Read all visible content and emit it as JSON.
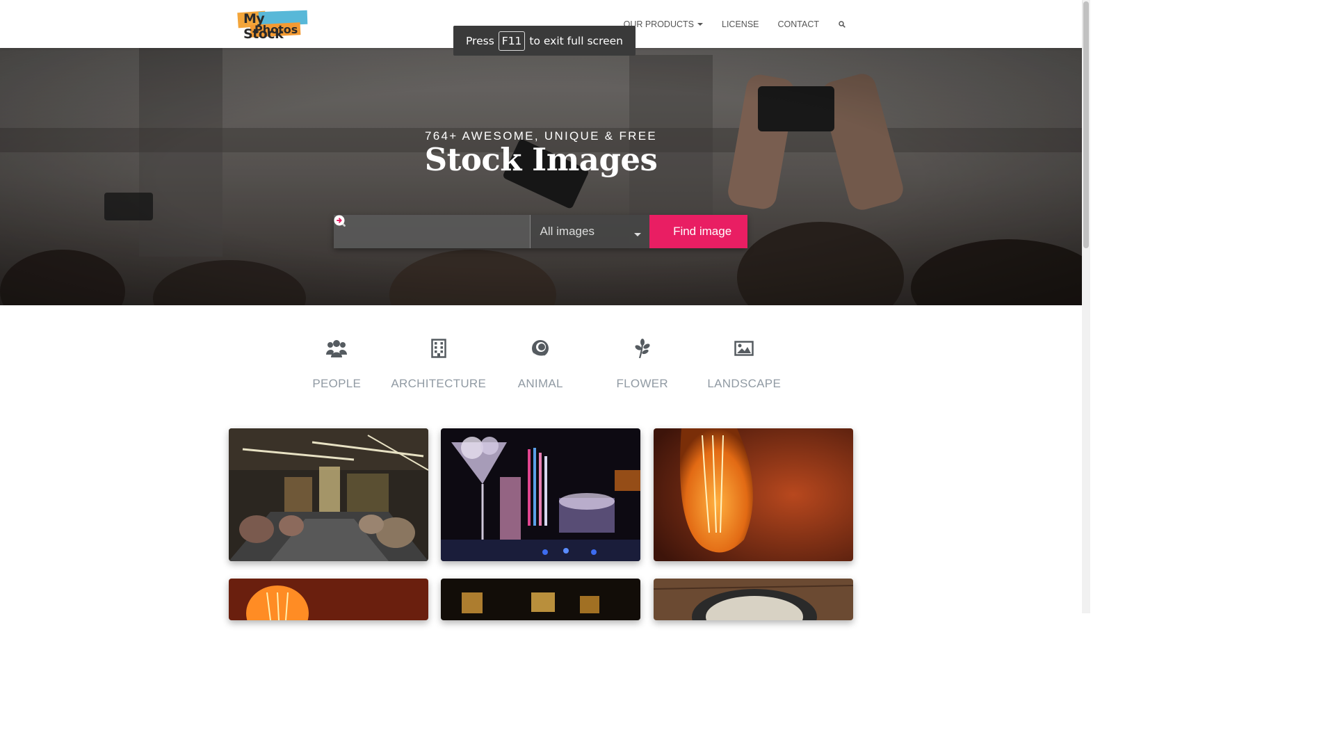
{
  "nav": {
    "logo_line1": "My Stock",
    "logo_line2": "Photos",
    "items": [
      {
        "label": "OUR PRODUCTS",
        "has_caret": true
      },
      {
        "label": "LICENSE"
      },
      {
        "label": "CONTACT"
      }
    ],
    "search_icon": "search-icon"
  },
  "fullscreen_notice": {
    "prefix": "Press",
    "key": "F11",
    "suffix": "to exit full screen"
  },
  "hero": {
    "subtitle": "764+ AWESOME, UNIQUE & FREE",
    "title": "Stock Images",
    "search": {
      "placeholder": "",
      "value": "",
      "select_value": "All images",
      "button_label": "Find image"
    }
  },
  "categories": [
    {
      "label": "PEOPLE",
      "icon": "users-icon"
    },
    {
      "label": "ARCHITECTURE",
      "icon": "building-icon"
    },
    {
      "label": "ANIMAL",
      "icon": "animal-icon"
    },
    {
      "label": "FLOWER",
      "icon": "leaf-icon"
    },
    {
      "label": "LANDSCAPE",
      "icon": "image-icon"
    }
  ],
  "gallery": [
    {
      "subject": "restaurant interior"
    },
    {
      "subject": "cocktail glass with ice"
    },
    {
      "subject": "glowing filament light bulb"
    },
    {
      "subject": "glowing filament light bulb"
    },
    {
      "subject": "hanging lamps"
    },
    {
      "subject": "bowl on wooden table"
    }
  ],
  "colors": {
    "accent": "#e91e63",
    "nav_text": "#555555",
    "category_text": "#909aa3"
  }
}
